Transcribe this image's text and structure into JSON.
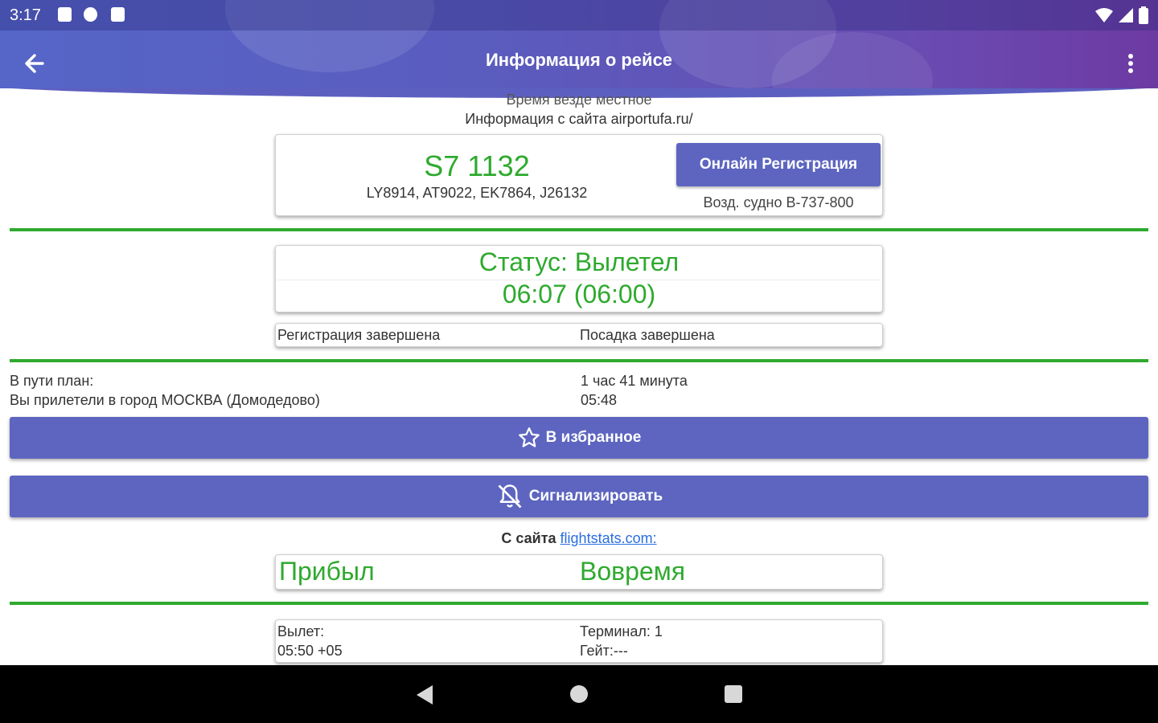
{
  "status_bar": {
    "time": "3:17"
  },
  "app_bar": {
    "title": "Информация о рейсе"
  },
  "info": {
    "timezone_note": "Время везде местное",
    "source_note": "Информация с сайта airportufa.ru/"
  },
  "flight_card": {
    "flight_number": "S7 1132",
    "codeshares": "LY8914, AT9022, EK7864, J26132",
    "online_checkin_label": "Онлайн Регистрация",
    "aircraft": "Возд. судно B-737-800"
  },
  "status_card": {
    "status": "Статус: Вылетел",
    "time": "06:07 (06:00)"
  },
  "process_card": {
    "checkin": "Регистрация завершена",
    "boarding": "Посадка завершена"
  },
  "route": {
    "en_route_label": "В пути план:",
    "en_route_value": "1 час 41 минута",
    "arrived_label": "Вы прилетели в город МОСКВА (Домодедово)",
    "arrived_value": "05:48"
  },
  "buttons": {
    "favorite_label": "В избранное",
    "notify_label": "Сигнализировать"
  },
  "flightstats": {
    "prefix": "С сайта",
    "link": "flightstats.com:",
    "state": "Прибыл",
    "punctuality": "Вовремя"
  },
  "departure_card": {
    "departure_label": "Вылет:",
    "departure_time": "05:50 +05",
    "terminal": "Терминал: 1",
    "gate": "Гейт:---"
  },
  "colors": {
    "primary": "#5d65c0",
    "accent_green": "#2eaa2e",
    "link": "#2a6ee0"
  },
  "icons": {
    "favorite": "star-outline-icon",
    "notify": "bell-off-icon",
    "back": "arrow-back-icon",
    "menu": "more-vert-icon"
  }
}
